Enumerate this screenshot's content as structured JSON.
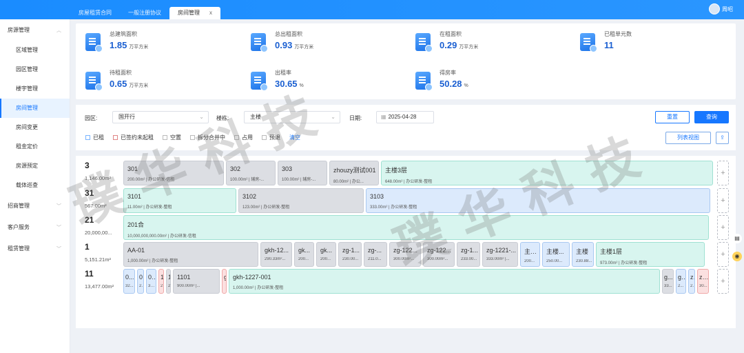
{
  "tabs": [
    {
      "label": "房屋租赁合同",
      "active": false
    },
    {
      "label": "一般注册协议",
      "active": false
    },
    {
      "label": "房间管理",
      "active": true,
      "close": "x"
    }
  ],
  "user": {
    "name": "周昭"
  },
  "sidebar": {
    "groups": [
      {
        "label": "房源管理",
        "expanded": true,
        "items": [
          "区域管理",
          "园区管理",
          "楼宇管理",
          "房间管理",
          "房间变更",
          "租金定价",
          "房源预定",
          "载体巡查"
        ]
      },
      {
        "label": "招商管理",
        "expanded": false
      },
      {
        "label": "客户服务",
        "expanded": false
      },
      {
        "label": "租赁管理",
        "expanded": false
      }
    ],
    "active_item": "房间管理"
  },
  "stats": [
    {
      "label": "总建筑面积",
      "value": "1.85",
      "unit": "万平方米"
    },
    {
      "label": "总出租面积",
      "value": "0.93",
      "unit": "万平方米"
    },
    {
      "label": "在租面积",
      "value": "0.29",
      "unit": "万平方米"
    },
    {
      "label": "已租单元数",
      "value": "11",
      "unit": ""
    },
    {
      "label": "待租面积",
      "value": "0.65",
      "unit": "万平方米"
    },
    {
      "label": "出租率",
      "value": "30.65",
      "unit": "%"
    },
    {
      "label": "得房率",
      "value": "50.28",
      "unit": "%"
    }
  ],
  "filter": {
    "park_label": "园区:",
    "park_value": "国开行",
    "building_label": "楼栋:",
    "building_value": "主楼",
    "date_label": "日期:",
    "date_value": "2025-04-28",
    "reset_label": "重置",
    "search_label": "查询",
    "list_view_label": "列表视图",
    "legend": [
      "已租",
      "已签约未起租",
      "空置",
      "拆分合并中",
      "占用",
      "预退"
    ],
    "clear_label": "清空"
  },
  "floors": [
    {
      "num": "3",
      "area": "1,146.00m²",
      "units": [
        {
          "name": "301",
          "info": "200.00m²  |  办公研发-信租",
          "color": "gray"
        },
        {
          "name": "302",
          "info": "100.00m²  |  辅房-...",
          "color": "gray"
        },
        {
          "name": "303",
          "info": "100.00m²  |  辅房-...",
          "color": "gray"
        },
        {
          "name": "zhouzy测试001",
          "info": "80.00m²  |  办公...",
          "color": "gray"
        },
        {
          "name": "主楼3层",
          "info": "648.00m²  |  办公研发-整租",
          "color": "green"
        }
      ]
    },
    {
      "num": "31",
      "area": "567.00m²",
      "units": [
        {
          "name": "3101",
          "info": "11.00m²  |  办公研发-整租",
          "color": "green"
        },
        {
          "name": "3102",
          "info": "123.00m²  |  办公研发-整租",
          "color": "gray"
        },
        {
          "name": "3103",
          "info": "333.00m²  |  办公研发-整租",
          "color": "blue"
        }
      ]
    },
    {
      "num": "21",
      "area": "20,000,00...",
      "units": [
        {
          "name": "201合",
          "info": "10,000,000,000.00m²  |  办公研发-信租",
          "color": "green"
        }
      ]
    },
    {
      "num": "1",
      "area": "5,151.21m²",
      "units": [
        {
          "name": "AA-01",
          "info": "1,000.00m²  |  办公研发-整租",
          "color": "gray"
        },
        {
          "name": "gkh-12...",
          "info": "290.33m²...",
          "color": "gray"
        },
        {
          "name": "gk...",
          "info": "200...",
          "color": "gray"
        },
        {
          "name": "gk...",
          "info": "200...",
          "color": "gray"
        },
        {
          "name": "zg-1...",
          "info": "230.00...",
          "color": "gray"
        },
        {
          "name": "zg-...",
          "info": "211.0...",
          "color": "gray"
        },
        {
          "name": "zg-122...",
          "info": "300.00m²...",
          "color": "gray"
        },
        {
          "name": "zg-122...",
          "info": "300.00m²...",
          "color": "gray"
        },
        {
          "name": "zg-1...",
          "info": "233.00...",
          "color": "gray"
        },
        {
          "name": "zg-1221-...",
          "info": "333.00m²  |...",
          "color": "gray"
        },
        {
          "name": "主楼...",
          "info": "200...",
          "color": "blue"
        },
        {
          "name": "主楼...",
          "info": "250.00...",
          "color": "blue"
        },
        {
          "name": "主楼",
          "info": "230.88...",
          "color": "blue"
        },
        {
          "name": "主楼1层",
          "info": "973.00m²  |  办公研发-整租",
          "color": "green"
        }
      ]
    },
    {
      "num": "11",
      "area": "13,477.00m²",
      "units": [
        {
          "name": "0...",
          "info": "32...",
          "color": "blue"
        },
        {
          "name": "0...",
          "info": "2...",
          "color": "blue"
        },
        {
          "name": "0...",
          "info": "30...",
          "color": "blue"
        },
        {
          "name": "1...",
          "info": "2...",
          "color": "red"
        },
        {
          "name": "1...",
          "info": "2...",
          "color": "gray"
        },
        {
          "name": "1101",
          "info": "900.00m²  |...",
          "color": "gray"
        },
        {
          "name": "g...",
          "info": "",
          "color": "red"
        },
        {
          "name": "gkh-1227-001",
          "info": "1,000.00m²  |  办公研发-整租",
          "color": "green"
        },
        {
          "name": "g...",
          "info": "33...",
          "color": "gray"
        },
        {
          "name": "g...",
          "info": "2...",
          "color": "blue"
        },
        {
          "name": "z...",
          "info": "2...",
          "color": "blue"
        },
        {
          "name": "zl...",
          "info": "30...",
          "color": "red"
        }
      ]
    }
  ],
  "add_label": "+",
  "watermark": "璞华科技"
}
